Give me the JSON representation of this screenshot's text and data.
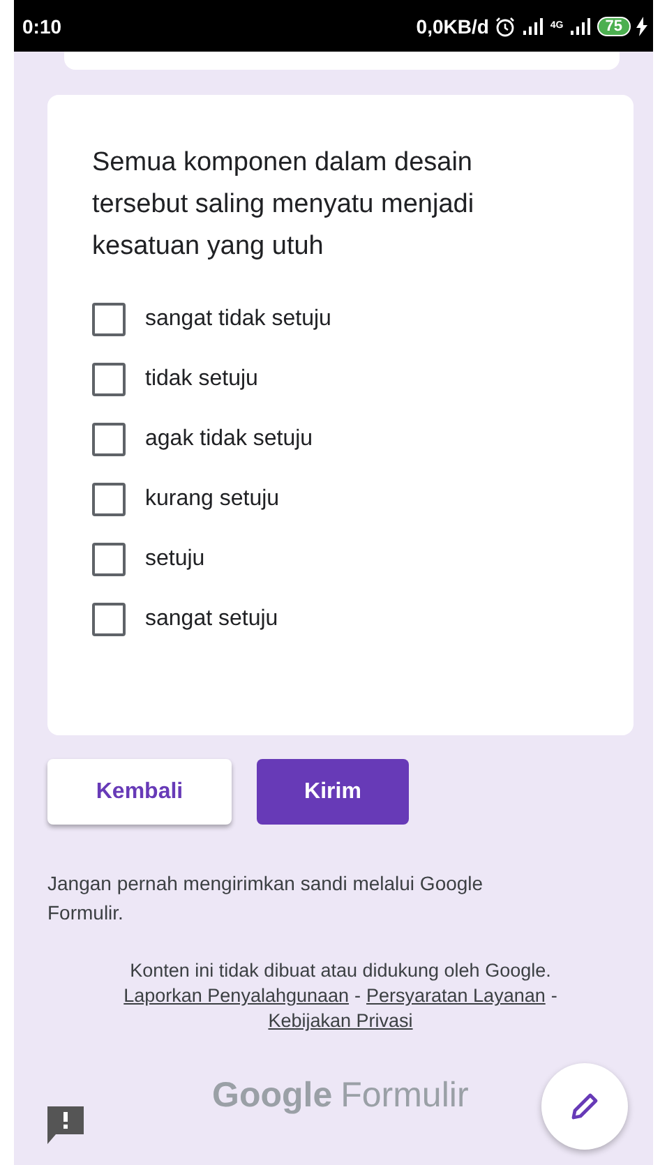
{
  "status_bar": {
    "time": "0:10",
    "data_rate": "0,0KB/d",
    "network": "4G",
    "battery": "75"
  },
  "question": {
    "title": "Semua komponen dalam desain tersebut saling menyatu menjadi kesatuan yang utuh",
    "options": [
      {
        "label": "sangat tidak setuju",
        "checked": false
      },
      {
        "label": "tidak setuju",
        "checked": false
      },
      {
        "label": "agak tidak setuju",
        "checked": false
      },
      {
        "label": "kurang setuju",
        "checked": false
      },
      {
        "label": "setuju",
        "checked": false
      },
      {
        "label": "sangat setuju",
        "checked": false
      }
    ]
  },
  "buttons": {
    "back": "Kembali",
    "submit": "Kirim"
  },
  "warning": "Jangan pernah mengirimkan sandi melalui Google Formulir.",
  "footer": {
    "disclaimer": "Konten ini tidak dibuat atau didukung oleh Google.",
    "links": [
      "Laporkan Penyalahgunaan",
      "Persyaratan Layanan",
      "Kebijakan Privasi"
    ],
    "separator": "-"
  },
  "logo": {
    "brand": "Google",
    "product": "Formulir"
  }
}
